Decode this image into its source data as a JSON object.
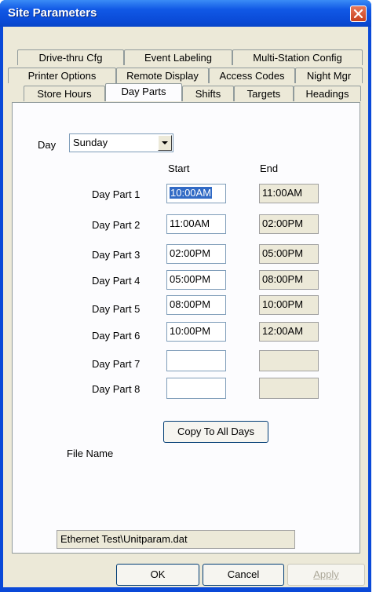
{
  "window": {
    "title": "Site Parameters"
  },
  "tabs": {
    "row1": [
      "Drive-thru Cfg",
      "Event Labeling",
      "Multi-Station Config"
    ],
    "row2": [
      "Printer Options",
      "Remote Display",
      "Access Codes",
      "Night Mgr"
    ],
    "row3": [
      "Store Hours",
      "Day Parts",
      "Shifts",
      "Targets",
      "Headings"
    ],
    "active": "Day Parts"
  },
  "day_select": {
    "label": "Day",
    "value": "Sunday"
  },
  "columns": {
    "start": "Start",
    "end": "End"
  },
  "day_parts": [
    {
      "label": "Day Part 1",
      "start": "10:00AM",
      "end": "11:00AM"
    },
    {
      "label": "Day Part 2",
      "start": "11:00AM",
      "end": "02:00PM"
    },
    {
      "label": "Day Part 3",
      "start": "02:00PM",
      "end": "05:00PM"
    },
    {
      "label": "Day Part 4",
      "start": "05:00PM",
      "end": "08:00PM"
    },
    {
      "label": "Day Part 5",
      "start": "08:00PM",
      "end": "10:00PM"
    },
    {
      "label": "Day Part 6",
      "start": "10:00PM",
      "end": "12:00AM"
    },
    {
      "label": "Day Part 7",
      "start": "",
      "end": ""
    },
    {
      "label": "Day Part 8",
      "start": "",
      "end": ""
    }
  ],
  "copy_button": "Copy To All Days",
  "file": {
    "label": "File Name",
    "value": "Ethernet Test\\Unitparam.dat"
  },
  "buttons": {
    "ok": "OK",
    "cancel": "Cancel",
    "apply": "Apply"
  },
  "icons": {
    "close": "close-icon",
    "dropdown": "chevron-down-icon"
  },
  "colors": {
    "titlebar": "#0a49d8",
    "selection": "#316ac5",
    "close": "#c8401c"
  }
}
